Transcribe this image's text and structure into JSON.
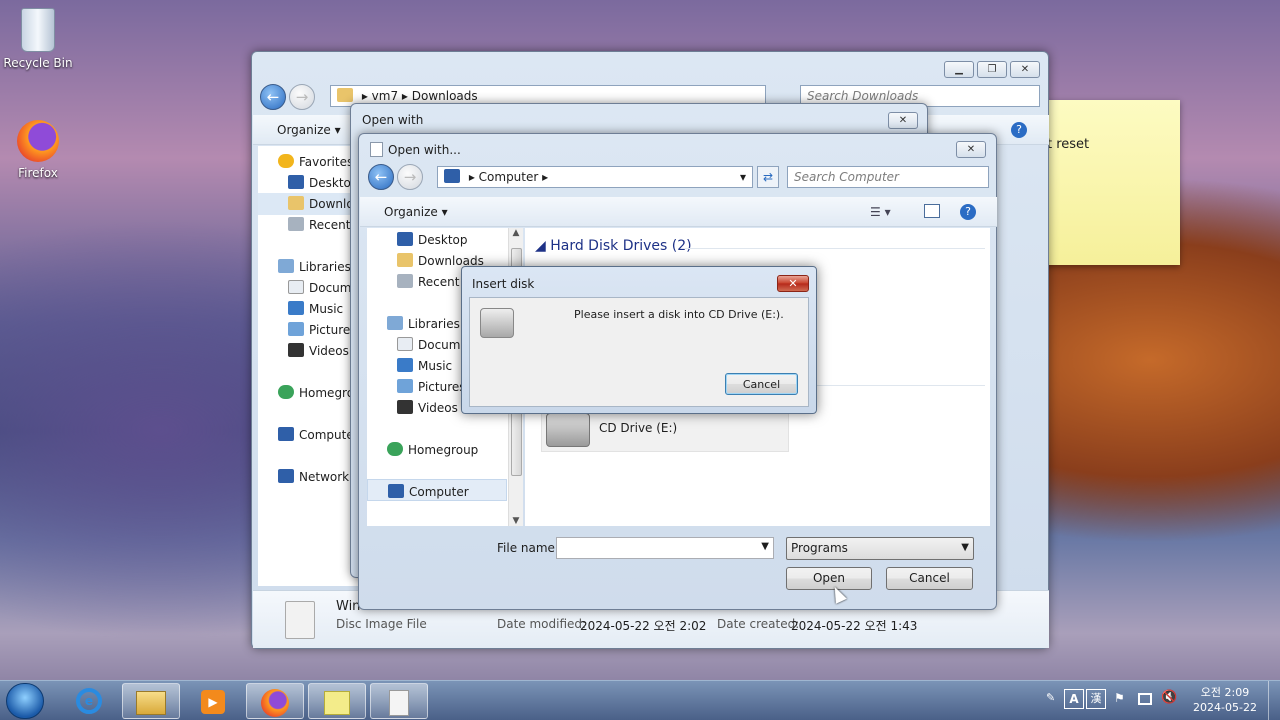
{
  "desktop": {
    "icons": [
      {
        "label": "Recycle Bin",
        "icon": "recycle-bin-icon"
      },
      {
        "label": "Firefox",
        "icon": "firefox-icon"
      }
    ],
    "sticky_note_text": "t reset"
  },
  "explorer": {
    "breadcrumb": [
      "vm7",
      "Downloads"
    ],
    "search_placeholder": "Search Downloads",
    "organize_label": "Organize",
    "nav": {
      "favorites": "Favorites",
      "favorites_items": [
        "Desktop",
        "Downloads",
        "Recent Places"
      ],
      "libraries": "Libraries",
      "library_items": [
        "Documents",
        "Music",
        "Pictures",
        "Videos"
      ],
      "homegroup": "Homegroup",
      "computer": "Computer",
      "network": "Network"
    },
    "details": {
      "file_name": "Win",
      "file_type": "Disc Image File",
      "date_modified_label": "Date modified:",
      "date_modified": "2024-05-22 오전 2:02",
      "date_created_label": "Date created:",
      "date_created": "2024-05-22 오전 1:43"
    }
  },
  "open_with": {
    "title": "Open with"
  },
  "open_dialog": {
    "title": "Open with...",
    "breadcrumb": [
      "Computer"
    ],
    "search_placeholder": "Search Computer",
    "organize_label": "Organize",
    "nav": {
      "favorites_items": [
        "Desktop",
        "Downloads",
        "Recent Places"
      ],
      "libraries": "Libraries",
      "library_items": [
        "Documents",
        "Music",
        "Pictures",
        "Videos"
      ],
      "homegroup": "Homegroup",
      "computer": "Computer"
    },
    "section_header": "Hard Disk Drives (2)",
    "drive_label": "CD Drive (E:)",
    "file_name_label": "File name:",
    "file_name_value": "",
    "file_type_value": "Programs",
    "open_label": "Open",
    "cancel_label": "Cancel"
  },
  "insert_disk": {
    "title": "Insert disk",
    "close_label": "✕",
    "message": "Please insert a disk into CD Drive (E:).",
    "cancel_label": "Cancel"
  },
  "taskbar": {
    "items": [
      "start-orb",
      "internet-explorer",
      "windows-explorer",
      "media-player",
      "firefox",
      "sticky-notes",
      "disc-image"
    ],
    "ime_mode": "A",
    "ime_hanja": "漢",
    "time": "오전 2:09",
    "date": "2024-05-22"
  }
}
